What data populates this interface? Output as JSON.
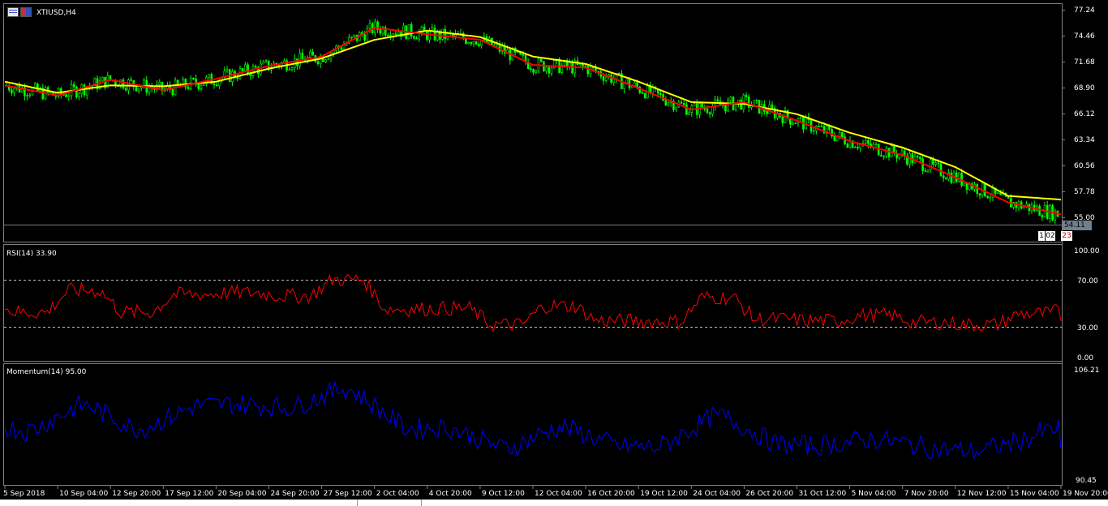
{
  "window": {
    "symbol_title": "XTIUSD,H4"
  },
  "main_pane": {
    "price_axis": [
      "77.24",
      "74.46",
      "71.68",
      "68.90",
      "66.12",
      "63.34",
      "60.56",
      "57.78",
      "55.00"
    ],
    "current_price_label": "54.11",
    "tag_left": "1",
    "tag_mid": "02",
    "tag_right": "23",
    "colors": {
      "candle": "#00ff00",
      "ma_fast": "#ff0000",
      "ma_slow": "#ffff00",
      "price_line": "#708090"
    }
  },
  "rsi_pane": {
    "title": "RSI(14) 33.90",
    "levels": [
      "100.00",
      "70.00",
      "30.00",
      "0.00"
    ],
    "color": "#ff0000"
  },
  "momentum_pane": {
    "title": "Momentum(14) 95.00",
    "levels": [
      "106.21",
      "90.45"
    ],
    "color": "#0000ff"
  },
  "time_axis": [
    "5 Sep 2018",
    "10 Sep 04:00",
    "12 Sep 20:00",
    "17 Sep 12:00",
    "20 Sep 04:00",
    "24 Sep 20:00",
    "27 Sep 12:00",
    "2 Oct 04:00",
    "4 Oct 20:00",
    "9 Oct 12:00",
    "12 Oct 04:00",
    "16 Oct 20:00",
    "19 Oct 12:00",
    "24 Oct 04:00",
    "26 Oct 20:00",
    "31 Oct 12:00",
    "5 Nov 04:00",
    "7 Nov 20:00",
    "12 Nov 12:00",
    "15 Nov 04:00",
    "19 Nov 20:00"
  ],
  "chart_data": {
    "type": "line",
    "title": "XTIUSD,H4",
    "x": [
      "5 Sep 2018",
      "10 Sep 04:00",
      "12 Sep 20:00",
      "17 Sep 12:00",
      "20 Sep 04:00",
      "24 Sep 20:00",
      "27 Sep 12:00",
      "2 Oct 04:00",
      "4 Oct 20:00",
      "9 Oct 12:00",
      "12 Oct 04:00",
      "16 Oct 20:00",
      "19 Oct 12:00",
      "24 Oct 04:00",
      "26 Oct 20:00",
      "31 Oct 12:00",
      "5 Nov 04:00",
      "7 Nov 20:00",
      "12 Nov 12:00",
      "15 Nov 04:00",
      "19 Nov 20:00"
    ],
    "ylim": [
      54.11,
      77.24
    ],
    "series": [
      {
        "values": [
          69.1,
          68.0,
          69.7,
          68.6,
          69.8,
          71.2,
          72.2,
          75.3,
          74.6,
          74.0,
          71.3,
          71.0,
          68.8,
          66.5,
          67.3,
          65.3,
          63.1,
          61.6,
          59.2,
          56.5,
          55.2
        ]
      },
      {
        "values": [
          69.5,
          68.3,
          69.1,
          69.0,
          69.5,
          70.9,
          72.0,
          74.0,
          75.0,
          74.3,
          72.2,
          71.4,
          69.5,
          67.3,
          67.1,
          66.0,
          64.0,
          62.4,
          60.3,
          57.2,
          56.8
        ]
      }
    ],
    "rsi": {
      "ylim": [
        0,
        100
      ],
      "levels": [
        30,
        70
      ],
      "last": 33.9
    },
    "momentum": {
      "ylim": [
        90.45,
        106.21
      ],
      "last": 95.0
    }
  }
}
